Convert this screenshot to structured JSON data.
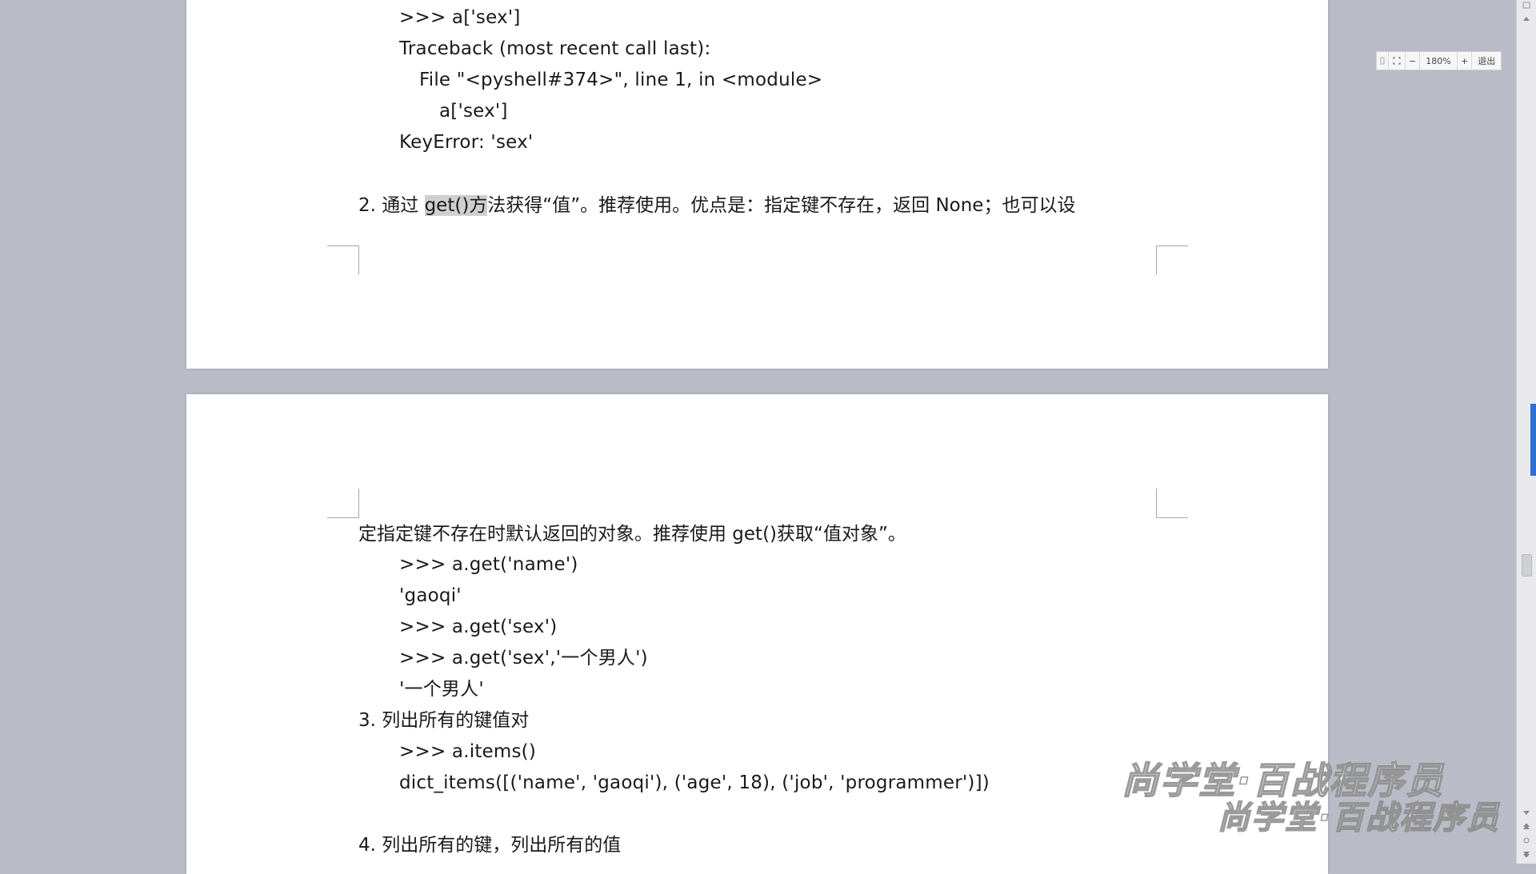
{
  "page1": {
    "lines": [
      ">>> a['sex']",
      "Traceback (most recent call last):",
      "File \"<pyshell#374>\", line 1, in <module>",
      "a['sex']",
      "KeyError: 'sex'"
    ],
    "item2_number": "2.",
    "item2_pre": "通过 ",
    "item2_highlight": "get()方",
    "item2_post": "法获得“值”。推荐使用。优点是：指定键不存在，返回 None；也可以设"
  },
  "page2": {
    "continuation": "定指定键不存在时默认返回的对象。推荐使用 get()获取“值对象”。",
    "code_get": [
      ">>> a.get('name')",
      "'gaoqi'",
      ">>> a.get('sex')",
      ">>> a.get('sex','一个男人')",
      "'一个男人'"
    ],
    "item3_number": "3.",
    "item3_text": "列出所有的键值对",
    "code_items": [
      ">>> a.items()",
      "dict_items([('name', 'gaoqi'), ('age', 18), ('job', 'programmer')])"
    ],
    "item4_number": "4.",
    "item4_text": "列出所有的键，列出所有的值"
  },
  "zoom": {
    "level": "180%",
    "minus": "−",
    "plus": "+",
    "exit_label": "退出"
  },
  "watermark": {
    "text": "尚学堂·百战程序员"
  },
  "colors": {
    "desk": "#b9bcc6",
    "highlight": "#cfcfcf",
    "accent_tab": "#2f6fd1"
  }
}
